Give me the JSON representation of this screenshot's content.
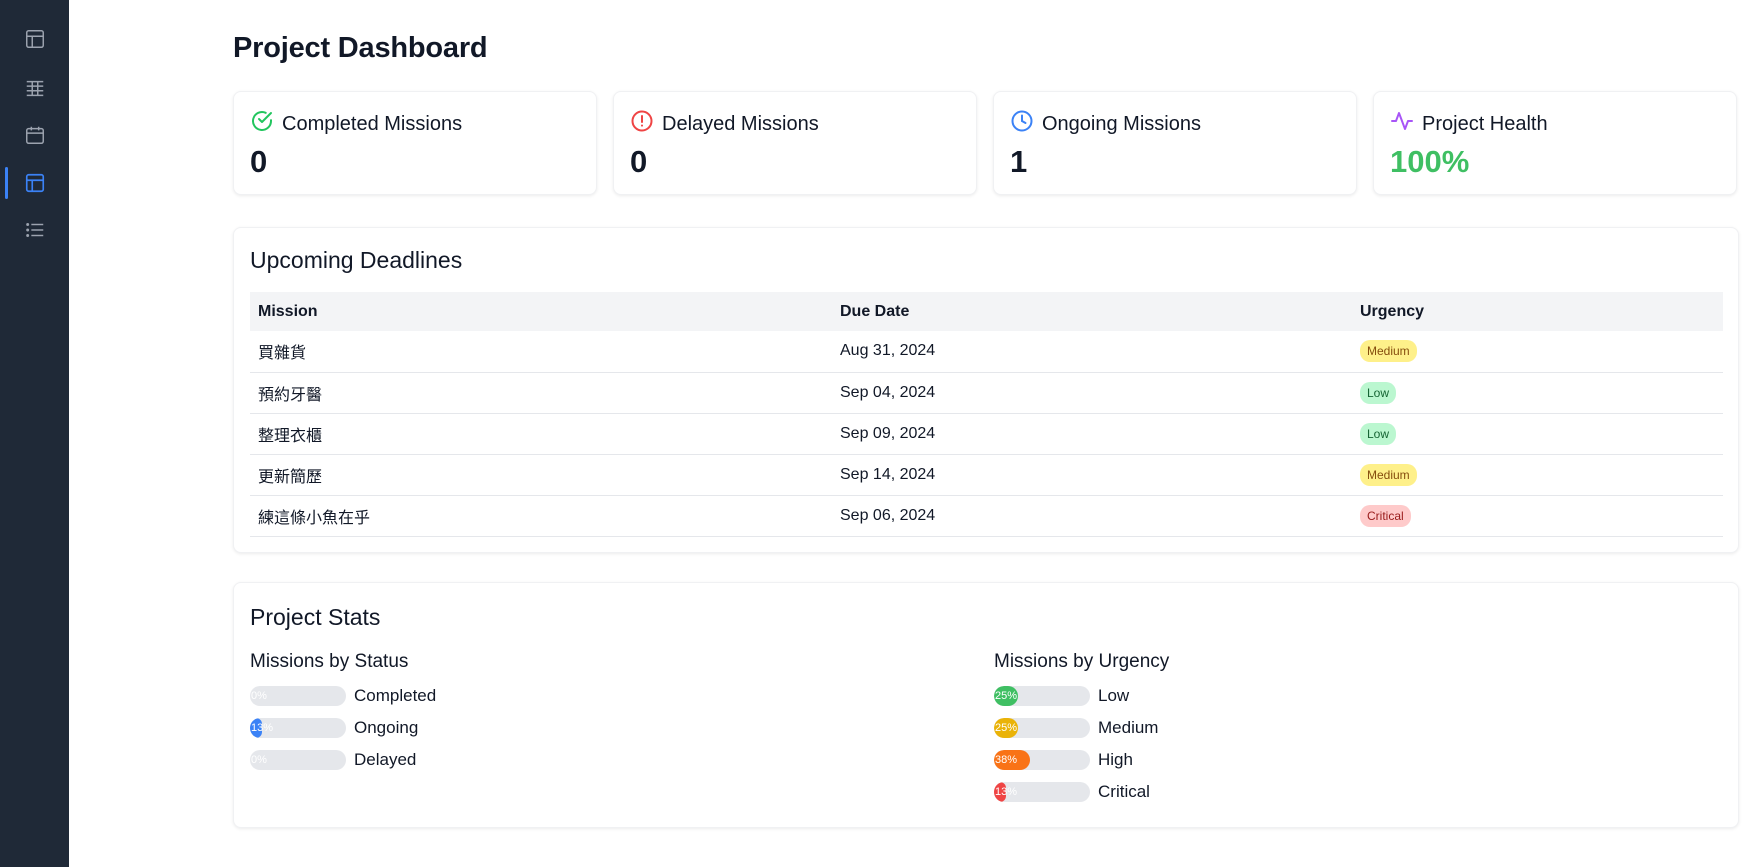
{
  "sidebar": {
    "items": [
      {
        "name": "table-icon"
      },
      {
        "name": "grid-icon"
      },
      {
        "name": "calendar-icon"
      },
      {
        "name": "dashboard-icon",
        "active": true
      },
      {
        "name": "list-icon"
      }
    ]
  },
  "page": {
    "title": "Project Dashboard"
  },
  "stats": [
    {
      "label": "Completed Missions",
      "value": "0",
      "icon": "check-circle-icon",
      "color": "#22c55e"
    },
    {
      "label": "Delayed Missions",
      "value": "0",
      "icon": "alert-circle-icon",
      "color": "#ef4444"
    },
    {
      "label": "Ongoing Missions",
      "value": "1",
      "icon": "clock-icon",
      "color": "#3b82f6"
    },
    {
      "label": "Project Health",
      "value": "100%",
      "icon": "activity-icon",
      "color": "#a855f7"
    }
  ],
  "deadlines": {
    "title": "Upcoming Deadlines",
    "columns": [
      "Mission",
      "Due Date",
      "Urgency"
    ],
    "rows": [
      {
        "mission": "買雜貨",
        "due": "Aug 31, 2024",
        "urgency": "Medium"
      },
      {
        "mission": "預約牙醫",
        "due": "Sep 04, 2024",
        "urgency": "Low"
      },
      {
        "mission": "整理衣櫃",
        "due": "Sep 09, 2024",
        "urgency": "Low"
      },
      {
        "mission": "更新簡歷",
        "due": "Sep 14, 2024",
        "urgency": "Medium"
      },
      {
        "mission": "練這條小魚在乎",
        "due": "Sep 06, 2024",
        "urgency": "Critical"
      }
    ]
  },
  "urgency_colors": {
    "Low": {
      "bg": "#bbf7d0",
      "fg": "#166534"
    },
    "Medium": {
      "bg": "#fef08a",
      "fg": "#854d0e"
    },
    "Critical": {
      "bg": "#fecaca",
      "fg": "#991b1b"
    }
  },
  "stats_section": {
    "title": "Project Stats",
    "by_status": {
      "title": "Missions by Status",
      "items": [
        {
          "label": "Completed",
          "pct": "0%",
          "fraction": 0.0,
          "color": "#22c55e"
        },
        {
          "label": "Ongoing",
          "pct": "13%",
          "fraction": 0.13,
          "color": "#3b82f6"
        },
        {
          "label": "Delayed",
          "pct": "0%",
          "fraction": 0.0,
          "color": "#ef4444"
        }
      ]
    },
    "by_urgency": {
      "title": "Missions by Urgency",
      "items": [
        {
          "label": "Low",
          "pct": "25%",
          "fraction": 0.25,
          "color": "#3fbf63"
        },
        {
          "label": "Medium",
          "pct": "25%",
          "fraction": 0.25,
          "color": "#eab308"
        },
        {
          "label": "High",
          "pct": "38%",
          "fraction": 0.38,
          "color": "#f97316"
        },
        {
          "label": "Critical",
          "pct": "13%",
          "fraction": 0.13,
          "color": "#ef4444"
        }
      ]
    }
  }
}
